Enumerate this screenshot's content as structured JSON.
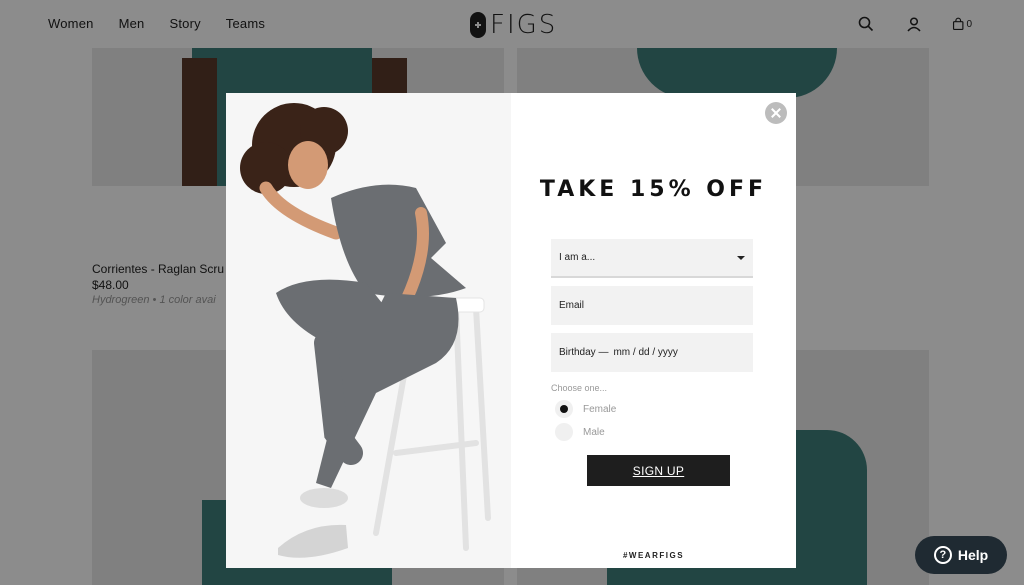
{
  "header": {
    "nav": [
      "Women",
      "Men",
      "Story",
      "Teams"
    ],
    "logo": "FIGS",
    "cart_count": "0"
  },
  "product": {
    "name": "Corrientes - Raglan Scru",
    "price": "$48.00",
    "color": "Hydrogreen • 1 color avai"
  },
  "modal": {
    "headline": "TAKE 15% OFF",
    "select": {
      "value": "I am a..."
    },
    "email": {
      "placeholder": "Email"
    },
    "birthday": {
      "label": "Birthday —",
      "placeholder": "mm / dd / yyyy"
    },
    "choose_label": "Choose one...",
    "options": [
      {
        "label": "Female",
        "checked": true
      },
      {
        "label": "Male",
        "checked": false
      }
    ],
    "signup_label": "SIGN UP",
    "hashtag": "#WEARFIGS"
  },
  "help": {
    "label": "Help"
  },
  "colors": {
    "brand_teal": "#3e7f7b",
    "button_dark": "#1e1e1e",
    "help_bg": "#1f2a32"
  }
}
